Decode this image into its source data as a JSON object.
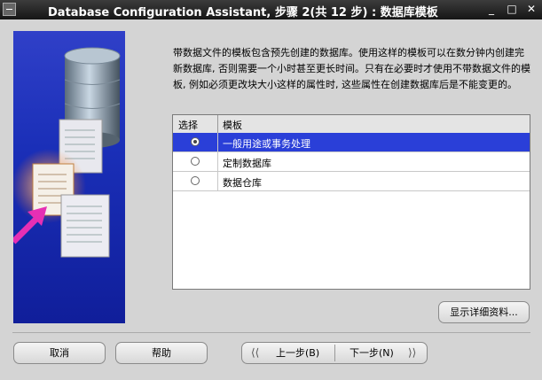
{
  "window": {
    "title": "Database Configuration Assistant, 步骤 2(共 12 步) : 数据库模板",
    "minimize_icon": "minimize-icon",
    "maximize_icon": "maximize-icon",
    "close_icon": "close-icon"
  },
  "description": "带数据文件的模板包含预先创建的数据库。使用这样的模板可以在数分钟内创建完新数据库, 否则需要一个小时甚至更长时间。只有在必要时才使用不带数据文件的模板, 例如必须更改块大小这样的属性时, 这些属性在创建数据库后是不能变更的。",
  "table": {
    "columns": [
      "选择",
      "模板"
    ],
    "rows": [
      {
        "label": "一般用途或事务处理",
        "selected": true
      },
      {
        "label": "定制数据库",
        "selected": false
      },
      {
        "label": "数据仓库",
        "selected": false
      }
    ]
  },
  "buttons": {
    "details": "显示详细资料...",
    "cancel": "取消",
    "help": "帮助",
    "back": "上一步(B)",
    "next": "下一步(N)"
  },
  "colors": {
    "selection": "#2a3fd8",
    "art_background": "#1a2fb8",
    "titlebar": "#222222"
  }
}
